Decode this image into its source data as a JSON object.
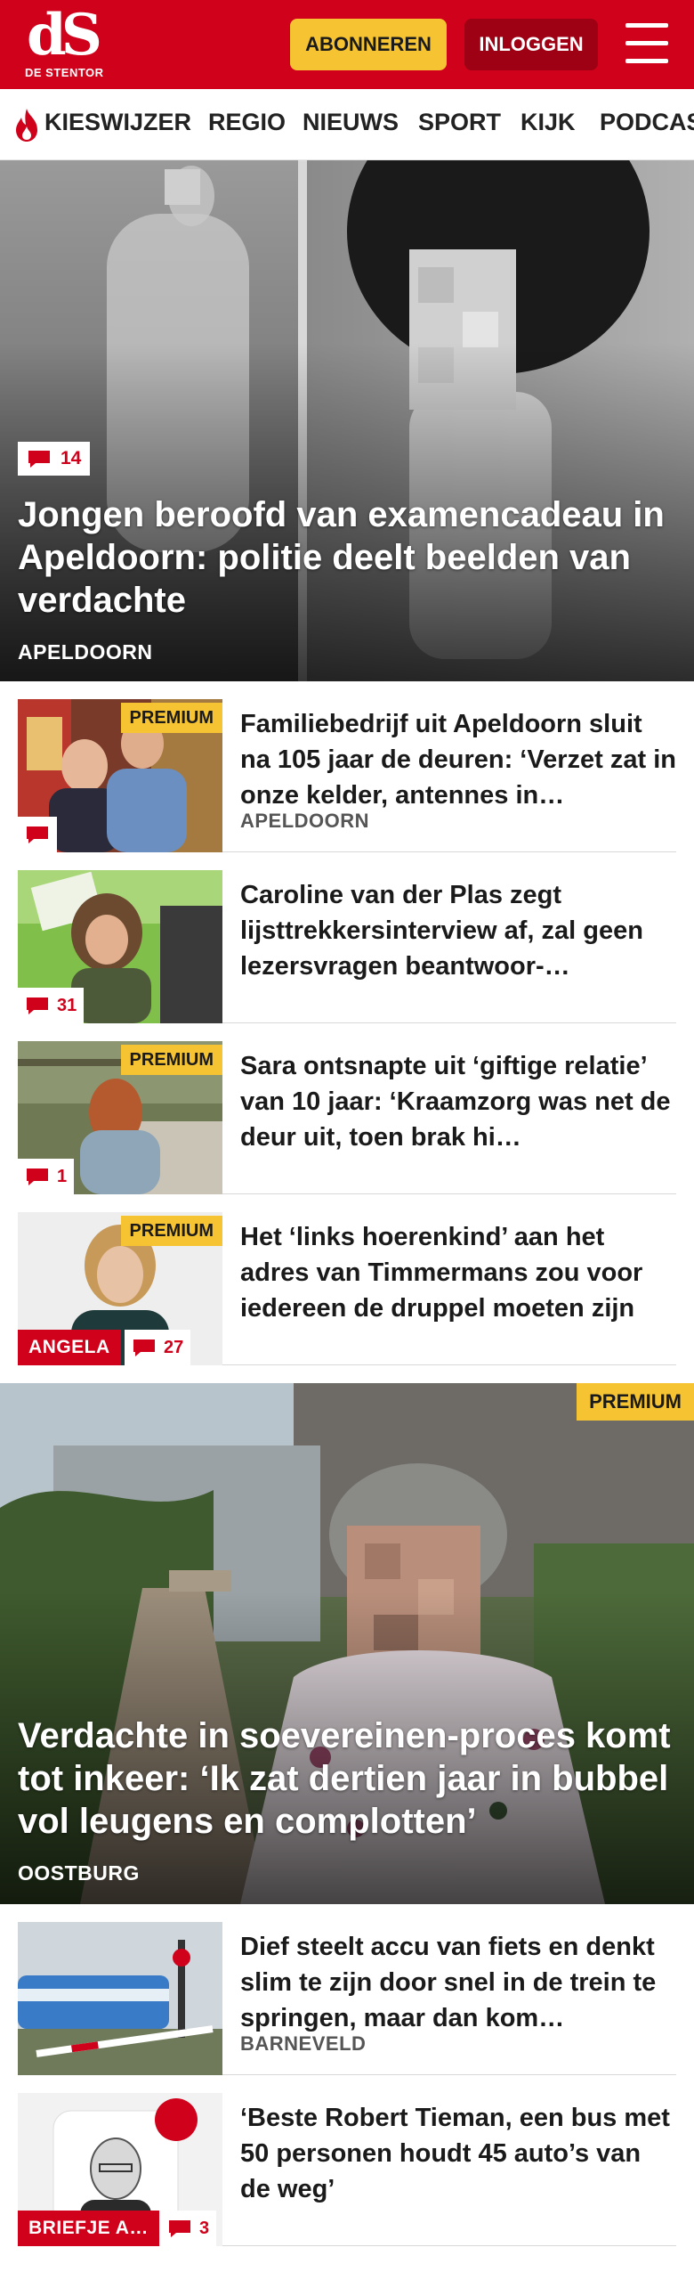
{
  "header": {
    "logo_mark": "dS",
    "logo_sub": "DE STENTOR",
    "subscribe_label": "ABONNEREN",
    "login_label": "INLOGGEN"
  },
  "nav": {
    "items": [
      "KIESWIJZER",
      "REGIO",
      "NIEUWS",
      "SPORT",
      "KIJK",
      "PODCAST"
    ]
  },
  "hero1": {
    "comments": "14",
    "title": "Jongen beroofd van examencadeau in Apeldoorn: politie deelt beelden van verdachte",
    "location": "APELDOORN"
  },
  "articles": [
    {
      "title": "Familiebedrijf uit Apeldoorn sluit na 105 jaar de deuren: ‘Verzet zat in onze kelder, antennes in…",
      "location": "APELDOORN",
      "premium": "PREMIUM",
      "comments": ""
    },
    {
      "title": "Caroline van der Plas zegt lijsttrekkersinterview af, zal geen lezersvragen beantwoor-…",
      "comments": "31"
    },
    {
      "title": "Sara ontsnapte uit ‘giftige relatie’ van 10 jaar: ‘Kraamzorg was net de deur uit, toen brak hi…",
      "premium": "PREMIUM",
      "comments": "1"
    },
    {
      "title": "Het ‘links hoerenkind’ aan het adres van Timmermans zou voor iedereen de druppel moeten zijn",
      "premium": "PREMIUM",
      "label": "ANGELA",
      "comments": "27"
    }
  ],
  "hero2": {
    "premium": "PREMIUM",
    "title": "Verdachte in soevereinen-proces komt tot inkeer: ‘Ik zat dertien jaar in bubbel vol leugens en complotten’",
    "location": "OOSTBURG"
  },
  "articles2": [
    {
      "title": "Dief steelt accu van fiets en denkt slim te zijn door snel in de trein te springen, maar dan kom…",
      "location": "BARNEVELD"
    },
    {
      "title": "‘Beste Robert Tieman, een bus met 50 personen houdt 45 auto’s van de weg’",
      "label": "BRIEFJE A…",
      "comments": "3"
    }
  ],
  "colors": {
    "brand_red": "#d0021b",
    "premium_yellow": "#f6c433",
    "login_dark_red": "#9e0014"
  },
  "icons": [
    "flame-icon",
    "comment-icon",
    "hamburger-menu-icon"
  ]
}
